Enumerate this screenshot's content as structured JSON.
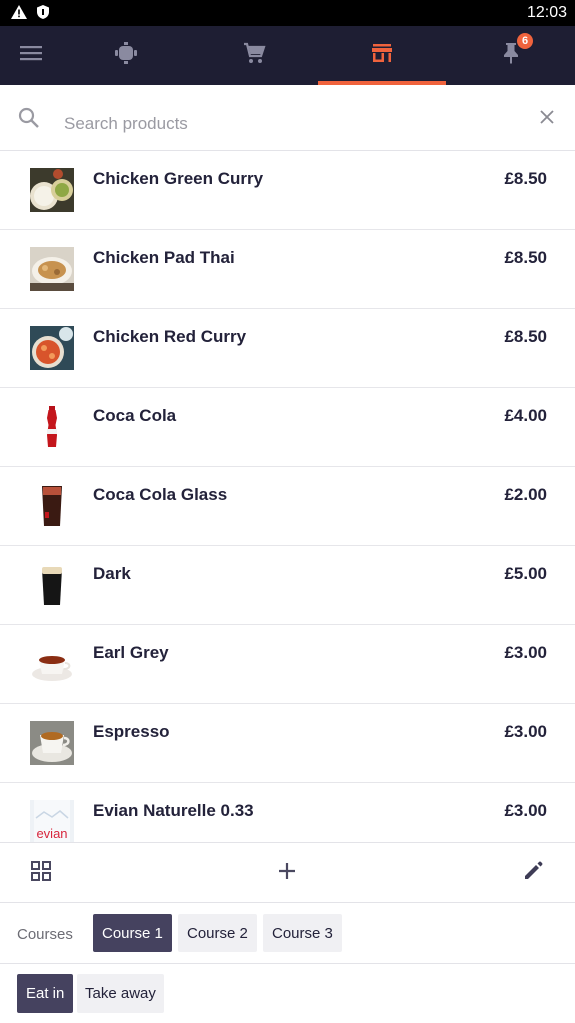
{
  "status_bar": {
    "time": "12:03",
    "icons": [
      "warning-icon",
      "shield-icon"
    ]
  },
  "nav": {
    "tabs": [
      {
        "icon": "menu-icon"
      },
      {
        "icon": "robot-icon"
      },
      {
        "icon": "cart-icon"
      },
      {
        "icon": "store-icon",
        "active": true
      },
      {
        "icon": "pin-icon",
        "badge": "6"
      }
    ],
    "accent_color": "#f0633d",
    "background_color": "#1e1e33"
  },
  "search": {
    "placeholder": "Search products",
    "value": ""
  },
  "products": [
    {
      "name": "Chicken Green Curry",
      "price": "£8.50"
    },
    {
      "name": "Chicken Pad Thai",
      "price": "£8.50"
    },
    {
      "name": "Chicken Red Curry",
      "price": "£8.50"
    },
    {
      "name": "Coca Cola",
      "price": "£4.00"
    },
    {
      "name": "Coca Cola Glass",
      "price": "£2.00"
    },
    {
      "name": "Dark",
      "price": "£5.00"
    },
    {
      "name": "Earl Grey",
      "price": "£3.00"
    },
    {
      "name": "Espresso",
      "price": "£3.00"
    },
    {
      "name": "Evian Naturelle 0.33",
      "price": "£3.00",
      "thumb_text": "evian"
    }
  ],
  "toolbar": {
    "icons": [
      "grid-icon",
      "plus-icon",
      "pencil-icon"
    ]
  },
  "courses": {
    "label": "Courses",
    "items": [
      {
        "label": "Course 1",
        "active": true
      },
      {
        "label": "Course 2"
      },
      {
        "label": "Course 3"
      }
    ]
  },
  "dining": {
    "items": [
      {
        "label": "Eat in",
        "active": true
      },
      {
        "label": "Take away"
      }
    ]
  }
}
